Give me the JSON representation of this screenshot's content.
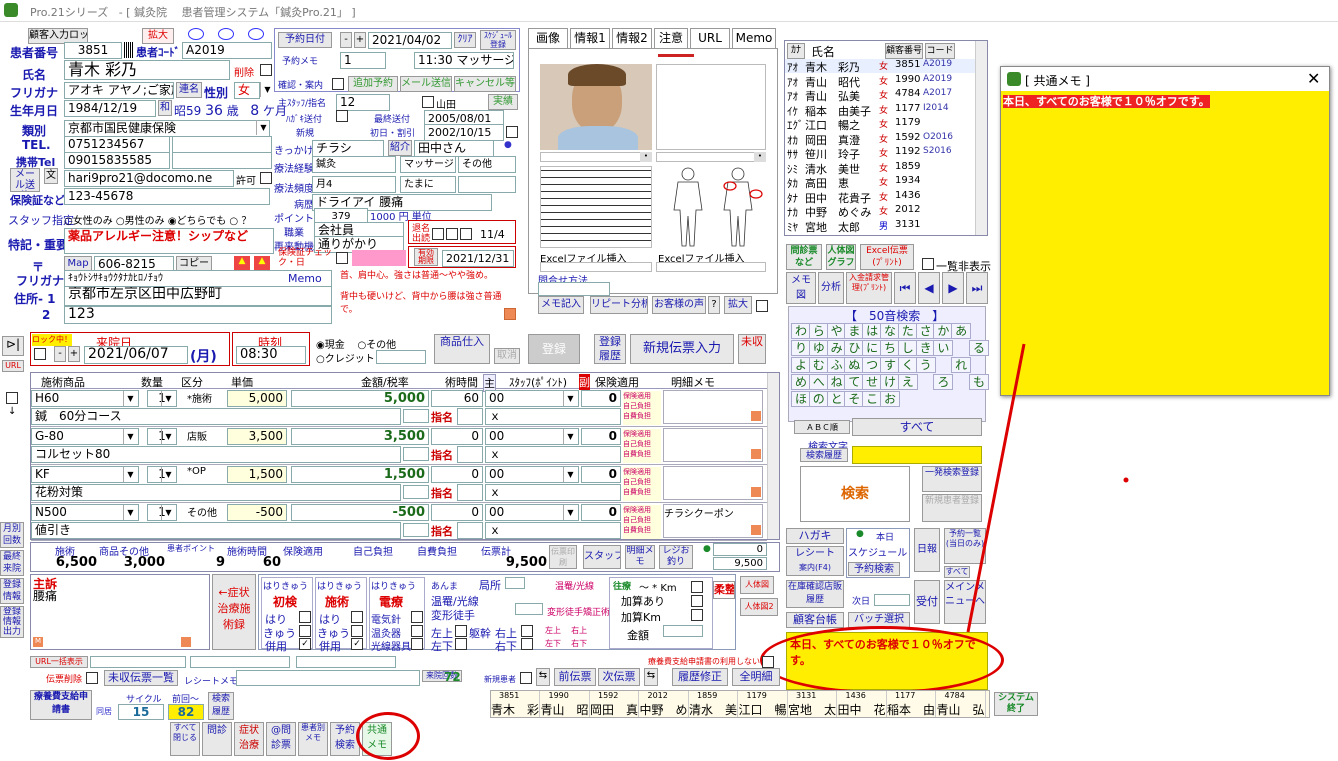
{
  "window": {
    "title_app": "Pro.21シリーズ",
    "title_main": "- [ 鍼灸院 　患者管理システム「鍼灸Pro.21」 ]"
  },
  "patient": {
    "lock_btn": "顧客入力ロック",
    "number_label": "患者番号",
    "number": "3851",
    "code_label": "患者ｺｰﾄﾞ",
    "code": "A2019",
    "expand": "拡大",
    "name_label": "氏名",
    "name": "青木 彩乃",
    "deleted_label": "削除",
    "kana_label": "フリガナ",
    "kana": "アオキ アヤノ;ご家族",
    "link_btn": "連名",
    "sex_label": "性別",
    "sex": "女",
    "birth_label": "生年月日",
    "birth": "1984/12/19",
    "era_btn": "和",
    "era": "昭59",
    "age": "36",
    "age_unit": "歳",
    "months": "8",
    "months_unit": "ケ月",
    "kind_label": "類別",
    "kind": "京都市国民健康保険",
    "tel_label": "TEL.",
    "tel": "0751234567",
    "mobile_label": "携帯Tel",
    "mobile": "09015835585",
    "mail_btn": "メール送信",
    "mail_label": "文",
    "mail": "hari9pro21@docomo.ne",
    "allow": "許可",
    "insurance_label": "保険証など",
    "insurance": "123-45678",
    "staff_label": "スタッフ指定",
    "staff_opts": [
      "女性のみ",
      "男性のみ",
      "どちらでも"
    ],
    "staff_q": "？",
    "feature_label": "特記・重要",
    "feature": "薬品アレルギー注意！シップなど",
    "zip_label": "〒",
    "map_btn": "Map",
    "zip": "606-8215",
    "copy_btn": "コピー",
    "addr_kana_label": "フリガナ",
    "addr_kana": "ｷｮｳﾄｼｻｷｮｳｸﾀﾅｶﾋﾛﾉﾁｮｳ",
    "addr1_label": "住所- 1",
    "addr1": "京都市左京区田中広野町",
    "addr2_label": "2",
    "addr2": "123"
  },
  "reserve": {
    "date_btn": "予約日付",
    "date": "2021/04/02",
    "clear": "ｸﾘｱ",
    "sched": "ｽｹｼﾞｭｰﾙ登録",
    "memo_label": "予約メモ",
    "memo_num": "1",
    "time": "11:30 マッサージ",
    "confirm": "確認・案内",
    "add": "追加予約",
    "mail": "メール送信",
    "cancel": "キャンセル等",
    "staff_label": "主ｽﾀｯﾌ/指名",
    "staff": "12",
    "staff_name": "山田",
    "result": "実績",
    "hagaki_label": "ﾊｶﾞｷ送付",
    "last_visit_label": "最終送付",
    "last_visit": "2005/08/01",
    "new_label": "新規",
    "first_label": "初日・割引",
    "first": "2002/10/15",
    "trigger_label": "きっかけ",
    "trigger": "チラシ",
    "intro_btn": "紹介",
    "intro": "田中さん",
    "therapy_label": "療法経験",
    "therapy1": "鍼灸",
    "therapy2": "マッサージ",
    "therapy3": "その他",
    "freq_label": "療法頻度",
    "freq1": "月4",
    "freq2": "たまに",
    "disease_label": "病歴",
    "disease": "ドライアイ 腰痛",
    "point_label": "ポイント",
    "point": "379",
    "yen": "1000 円 単位",
    "job_label": "職業",
    "job": "会社員",
    "revisit_label": "再来動機",
    "revisit": "通りがかり",
    "nocard_label": "保険証チェック・日",
    "dm_label": "退名出読",
    "dm_date": "11/4",
    "valid_btn": "有効期限",
    "valid": "2021/12/31",
    "memo_title": "Memo",
    "memo_text1": "首、肩中心。強さは普通～やや強め。",
    "memo_text2": "背中も硬いけど、背中から腰は強さ普通で。"
  },
  "tabs": [
    "画像",
    "情報1",
    "情報2",
    "注意",
    "URL",
    "Memo"
  ],
  "chart": {
    "excel1": "Excelファイル挿入",
    "excel2": "Excelファイル挿入",
    "contact_label": "問合せ方法",
    "btns": [
      "メモ記入",
      "リピート分析",
      "お客様の声",
      "?",
      "拡大"
    ]
  },
  "list": {
    "hdr_kana": "ｶﾅ",
    "hdr_name": "氏名",
    "hdr_num": "顧客番号",
    "hdr_code": "コード",
    "rows": [
      {
        "k": "ｱｵ",
        "n": "青木　彩乃",
        "s": "女",
        "num": "3851",
        "c": "A2019"
      },
      {
        "k": "ｱｵ",
        "n": "青山　昭代",
        "s": "女",
        "num": "1990",
        "c": "A2019"
      },
      {
        "k": "ｱｵ",
        "n": "青山　弘美",
        "s": "女",
        "num": "4784",
        "c": "A2017"
      },
      {
        "k": "ｲｹ",
        "n": "稲本　由美子",
        "s": "女",
        "num": "1177",
        "c": "I2014"
      },
      {
        "k": "ｴｸﾞ",
        "n": "江口　暢之",
        "s": "女",
        "num": "1179",
        "c": ""
      },
      {
        "k": "ｵｶ",
        "n": "岡田　真澄",
        "s": "女",
        "num": "1592",
        "c": "O2016"
      },
      {
        "k": "ｻｻ",
        "n": "笹川　玲子",
        "s": "女",
        "num": "1192",
        "c": "S2016"
      },
      {
        "k": "ｼﾐ",
        "n": "清水　美世",
        "s": "女",
        "num": "1859",
        "c": ""
      },
      {
        "k": "ﾀｶ",
        "n": "高田　恵",
        "s": "女",
        "num": "1934",
        "c": ""
      },
      {
        "k": "ﾀﾅ",
        "n": "田中　花貴子",
        "s": "女",
        "num": "1436",
        "c": ""
      },
      {
        "k": "ﾅｶ",
        "n": "中野　めぐみ",
        "s": "女",
        "num": "2012",
        "c": ""
      },
      {
        "k": "ﾐﾔ",
        "n": "宮地　太郎",
        "s": "男",
        "num": "3131",
        "c": ""
      }
    ]
  },
  "right": {
    "info_btn": "問診票など",
    "graph_btn": "人体図グラフ",
    "excel_btn": "Excel伝票(ﾌﾟﾘﾝﾄ)",
    "hide": "一覧非表示",
    "memo_btn": "メモ図",
    "analysis": "分析",
    "order_btn": "入金請求管理(ﾌﾟﾘﾝﾄ)",
    "search_title": "【　50音検索　】",
    "kana": [
      "わ",
      "ら",
      "や",
      "ま",
      "は",
      "な",
      "た",
      "さ",
      "か",
      "あ",
      "",
      "り",
      "ゆ",
      "み",
      "ひ",
      "に",
      "ち",
      "し",
      "き",
      "い",
      "",
      "る",
      "よ",
      "む",
      "ふ",
      "ぬ",
      "つ",
      "す",
      "く",
      "う",
      "",
      "れ",
      "",
      "め",
      "へ",
      "ね",
      "て",
      "せ",
      "け",
      "え",
      "",
      "ろ",
      "",
      "も",
      "ほ",
      "の",
      "と",
      "そ",
      "こ",
      "お"
    ],
    "abc": "ＡＢＣ順",
    "all": "すべて",
    "search_char": "検索文字",
    "search_hist": "検索履歴",
    "search": "検索",
    "one_search": "一発検索登録",
    "new_patient": "新規患者登録",
    "hagaki": "ハガキ",
    "receipt": "レシート",
    "receipt_sub": "案内(F4)",
    "today": "本日",
    "schedule": "スケジュール",
    "reserve_search": "予約検索",
    "nikki": "日報",
    "list_btn": "予約一覧(当日のみ)",
    "all_btn": "すべて",
    "stock": "在庫確認店販履歴",
    "next_day": "次日",
    "accept": "受付",
    "main_menu": "メインメニューへ",
    "ledger": "顧客台帳",
    "bulk": "バッチ選択"
  },
  "visit": {
    "lock": "ロック中！",
    "date_label": "来院日",
    "date": "2021/06/07",
    "day": "(月)",
    "time_label": "時刻",
    "time": "08:30",
    "cash": "現金",
    "other": "その他",
    "credit": "クレジット",
    "goods_in": "商品仕入",
    "cancel": "取消",
    "register": "登録",
    "reg_hist": "登録履歴",
    "new_slip": "新規伝票入力",
    "receipt_label": "未収"
  },
  "grid": {
    "headers": [
      "施術商品",
      "数量",
      "区分",
      "単価",
      "金額/税率",
      "術時間",
      "主",
      "ｽﾀｯﾌ(ﾎﾟｲﾝﾄ)",
      "副",
      "保険適用",
      "明細メモ"
    ],
    "rows": [
      {
        "code": "H60",
        "qty": "1",
        "kind": "*施術",
        "price": "5,000",
        "amt": "5,000",
        "min": "60",
        "staff": "00",
        "pt": "0",
        "name": "鍼　60分コース",
        "desig": "指名",
        "x": "ｘ",
        "memo": ""
      },
      {
        "code": "G-80",
        "qty": "1",
        "kind": "店販",
        "price": "3,500",
        "amt": "3,500",
        "min": "0",
        "staff": "00",
        "pt": "0",
        "name": "コルセット80",
        "desig": "指名",
        "x": "ｘ",
        "memo": ""
      },
      {
        "code": "KF",
        "qty": "1",
        "kind": "*OP",
        "price": "1,500",
        "amt": "1,500",
        "min": "0",
        "staff": "00",
        "pt": "0",
        "name": "花粉対策",
        "desig": "指名",
        "x": "ｘ",
        "memo": ""
      },
      {
        "code": "N500",
        "qty": "1",
        "kind": "その他",
        "price": "-500",
        "amt": "-500",
        "min": "0",
        "staff": "00",
        "pt": "0",
        "name": "値引き",
        "desig": "指名",
        "x": "ｘ",
        "memo": "チラシクーポン"
      }
    ],
    "ins_lines": [
      "保険適用",
      "自己負担",
      "自費負担"
    ]
  },
  "totals": {
    "labels": [
      "施術",
      "商品その他",
      "患者ポイント",
      "施術時間",
      "保険適用",
      "自己負担",
      "自費負担",
      "伝票計"
    ],
    "vals": [
      "6,500",
      "3,000",
      "9",
      "60",
      "",
      "",
      "",
      "9,500"
    ],
    "staff": "スタッフ",
    "meisai": "明細メモ",
    "regi": "レジお釣り",
    "v1": "0",
    "v2": "9,500"
  },
  "complaint": {
    "label": "主訴",
    "text": "腰痛",
    "symptom": "←症状治療施術録"
  },
  "treat": {
    "t1": "はりきゅう",
    "t1a": "初検",
    "t2": "はりきゅう",
    "t2a": "施術",
    "t3": "はりきゅう",
    "t3a": "電療",
    "hari": "はり",
    "kyu": "きゅう",
    "hei": "併用",
    "denki": "電気針",
    "onkyu": "温灸器",
    "kosen": "光線器具",
    "anma": "あんま",
    "kyokusho": "局所",
    "onpo": "温罨/光線",
    "henkei": "変形徒手",
    "sho": "上",
    "ka": "下",
    "left": "左",
    "right": "右",
    "taikan": "躯幹",
    "ourai": "往療",
    "km": "～ * Km",
    "kasan": "加算あり",
    "kasankm": "加算Km",
    "kingaku": "金額",
    "judo": "柔整",
    "body1": "人体図",
    "body2": "人体図2",
    "fukusho": "温罨/光線",
    "henkei2": "変形徒手矯正術"
  },
  "bottom": {
    "url_btn": "URL一括表示",
    "slip_del": "伝票削除",
    "unpaid": "未収伝票一覧",
    "receipt_memo": "レシートメモ",
    "visits_label": "来院回数",
    "visits": "72",
    "new_reg": "新規患者",
    "prev": "前伝票",
    "next": "次伝票",
    "hist_fix": "履歴修正",
    "print": "全明細",
    "dm_label": "療養費支給申請書の利用しない",
    "pay_label": "療養費支給申請書",
    "cycle_label": "サイクル",
    "cycle": "15",
    "prev_label": "前回～",
    "prev_val": "82",
    "search_hist": "検索履歴",
    "names": [
      "3851 青木　彩",
      "1990 青山　昭",
      "1592 岡田　真",
      "2012 中野　め",
      "1859 清水　美",
      "1179 江口　暢",
      "3131 宮地　太",
      "1436 田中　花",
      "1177 稲本　由",
      "4784 青山　弘"
    ],
    "sys_end": "システム終了",
    "tools": [
      "すべて閉じる",
      "問診",
      "症状治療",
      "@問診票",
      "患者別メモ",
      "予約検索",
      "共通メモ"
    ],
    "side": [
      "月別回数",
      "最終来院",
      "登録情報",
      "登録情報出力"
    ]
  },
  "common_memo": {
    "title": "[ 共通メモ ]",
    "text": "本日、すべてのお客様で１０％オフです。"
  },
  "memo_preview": "本日、すべてのお客様で１０％オフです。",
  "colors": {
    "accent": "#d00000",
    "yellow": "#ffee00",
    "label": "#1a1ab0"
  }
}
